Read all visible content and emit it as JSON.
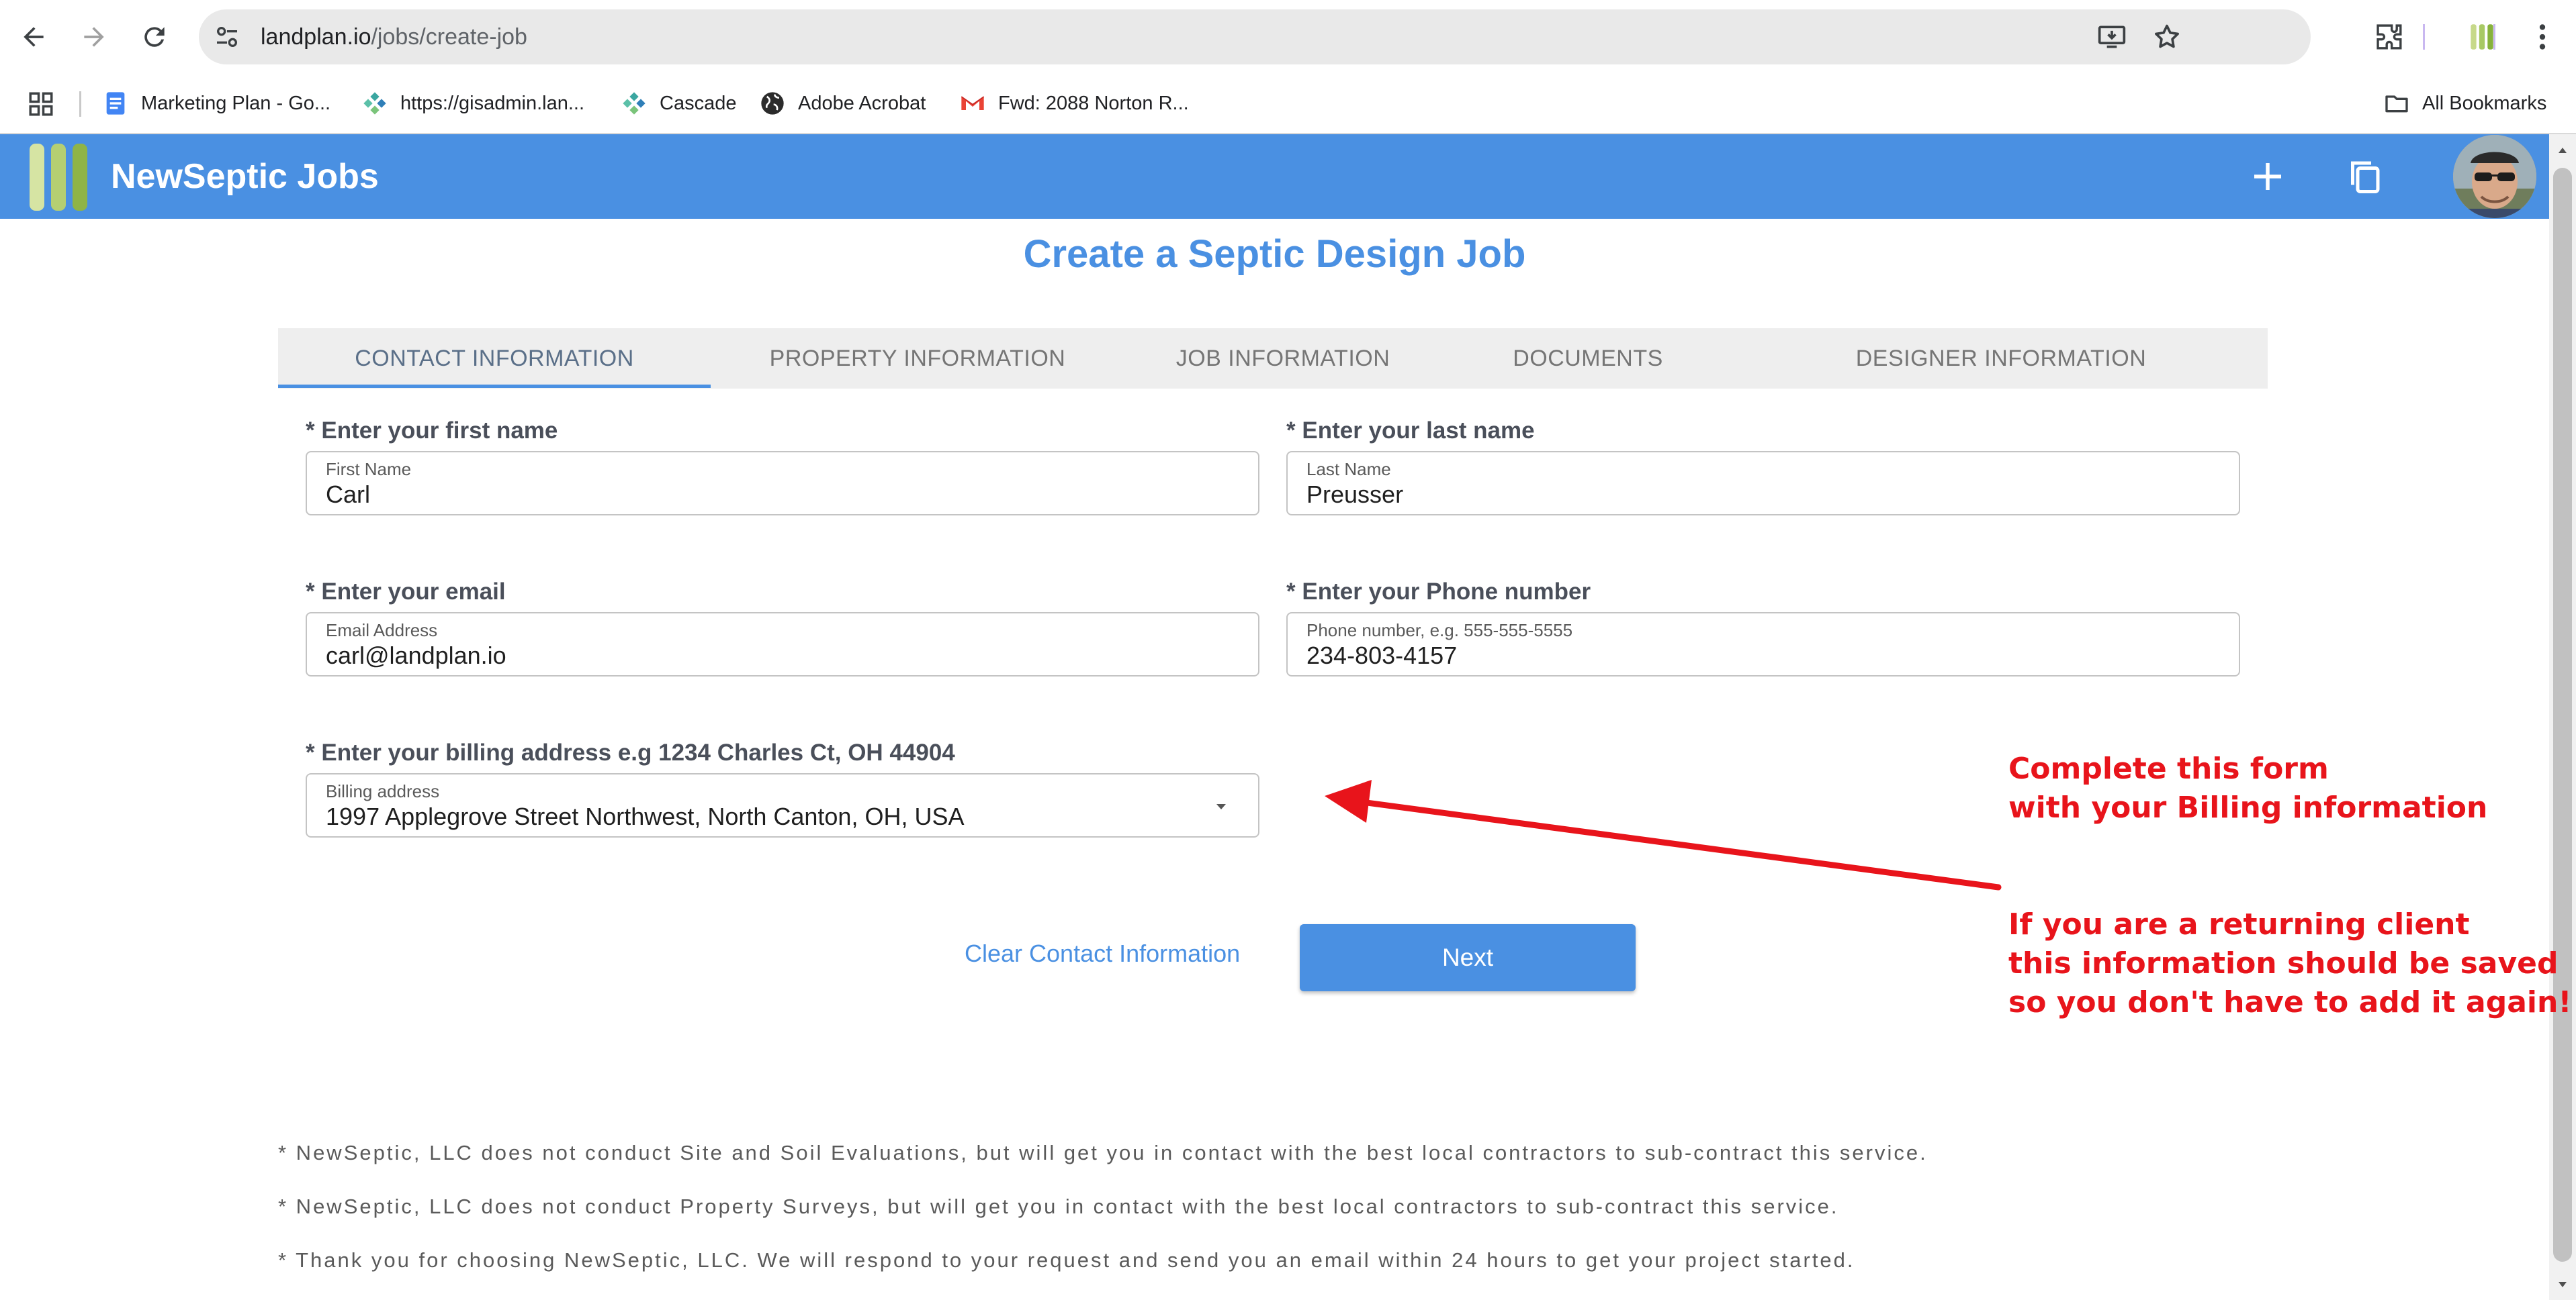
{
  "browser": {
    "url_host": "landplan.io",
    "url_path": "/jobs/create-job",
    "bookmarks": [
      {
        "label": "Marketing Plan - Go...",
        "icon": "google-docs-icon"
      },
      {
        "label": "https://gisadmin.lan...",
        "icon": "cascade-logo-icon"
      },
      {
        "label": "Cascade",
        "icon": "cascade-logo-icon"
      },
      {
        "label": "Adobe Acrobat",
        "icon": "globe-icon"
      },
      {
        "label": "Fwd: 2088 Norton R...",
        "icon": "gmail-icon"
      }
    ],
    "all_bookmarks_label": "All Bookmarks"
  },
  "header": {
    "app_title": "NewSeptic Jobs",
    "brand_color": "#4a90e2"
  },
  "page": {
    "title": "Create a Septic Design Job"
  },
  "tabs": [
    {
      "label": "CONTACT INFORMATION",
      "active": true
    },
    {
      "label": "PROPERTY INFORMATION",
      "active": false
    },
    {
      "label": "JOB INFORMATION",
      "active": false
    },
    {
      "label": "DOCUMENTS",
      "active": false
    },
    {
      "label": "DESIGNER INFORMATION",
      "active": false
    }
  ],
  "form": {
    "first_name": {
      "prompt": "* Enter your first name",
      "label": "First Name",
      "value": "Carl"
    },
    "last_name": {
      "prompt": "* Enter your last name",
      "label": "Last Name",
      "value": "Preusser"
    },
    "email": {
      "prompt": "* Enter your email",
      "label": "Email Address",
      "value": "carl@landplan.io"
    },
    "phone": {
      "prompt": "* Enter your Phone number",
      "label": "Phone number, e.g. 555-555-5555",
      "value": "234-803-4157"
    },
    "billing": {
      "prompt": "* Enter your billing address e.g 1234 Charles Ct, OH 44904",
      "label": "Billing address",
      "value": "1997 Applegrove Street Northwest, North Canton, OH, USA"
    },
    "clear_label": "Clear Contact Information",
    "next_label": "Next"
  },
  "annotation": {
    "color": "#e8141b",
    "line1": "Complete this form",
    "line2": "with your Billing information",
    "line3": "If you are a returning client",
    "line4": "this information should be saved",
    "line5": "so you don't have to add it again!"
  },
  "notes": [
    "* NewSeptic, LLC does not conduct Site and Soil Evaluations, but will get you in contact with the best local contractors to sub-contract this service.",
    "* NewSeptic, LLC does not conduct Property Surveys, but will get you in contact with the best local contractors to sub-contract this service.",
    "* Thank you for choosing NewSeptic, LLC. We will respond to your request and send you an email within 24 hours to get your project started."
  ]
}
